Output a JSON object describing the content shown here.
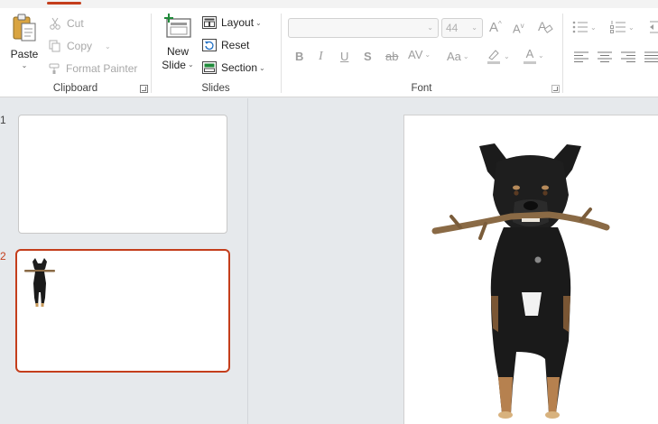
{
  "ribbon": {
    "clipboard": {
      "paste_label": "Paste",
      "cut_label": "Cut",
      "copy_label": "Copy",
      "format_painter_label": "Format Painter",
      "group_label": "Clipboard"
    },
    "slides": {
      "new_slide_line1": "New",
      "new_slide_line2": "Slide",
      "layout_label": "Layout",
      "reset_label": "Reset",
      "section_label": "Section",
      "group_label": "Slides"
    },
    "font": {
      "font_name_value": "",
      "font_size_value": "44",
      "group_label": "Font",
      "bold": "B",
      "italic": "I",
      "underline": "U",
      "shadow": "S",
      "strike": "ab",
      "spacing": "AV",
      "change_case": "Aa",
      "grow": "A",
      "shrink": "A",
      "font_color": "A"
    }
  },
  "thumbnails": {
    "slides": [
      {
        "number": "1"
      },
      {
        "number": "2"
      }
    ]
  },
  "colors": {
    "accent": "#c43e1c",
    "ribbon_bg": "#ffffff",
    "workspace_bg": "#e6e9ec"
  }
}
